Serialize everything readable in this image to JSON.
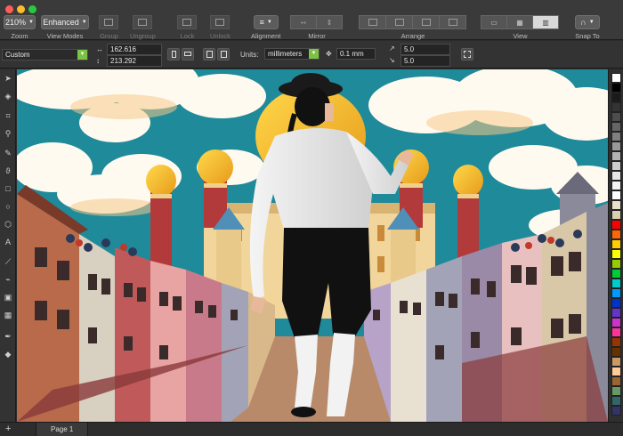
{
  "toolbar": {
    "zoom": {
      "value": "210%",
      "label": "Zoom"
    },
    "view_modes": {
      "value": "Enhanced",
      "label": "View Modes"
    },
    "group_label": "Group",
    "ungroup_label": "Ungroup",
    "lock_label": "Lock",
    "unlock_label": "Unlock",
    "alignment_label": "Alignment",
    "mirror_label": "Mirror",
    "arrange_label": "Arrange",
    "view_label": "View",
    "snap_to_label": "Snap To"
  },
  "property_bar": {
    "preset": "Custom",
    "x_value": "162.616",
    "y_value": "213.292",
    "units_label": "Units:",
    "units_value": "millimeters",
    "nudge_value": "0.1 mm",
    "duplicate_x": "5.0",
    "duplicate_y": "5.0"
  },
  "status": {
    "page_tab": "Page 1"
  },
  "colors": {
    "accent_green": "#7cc243",
    "sky": "#1f8a9a",
    "palette": [
      "#ffffff",
      "#000000",
      "#1a1a1a",
      "#333333",
      "#4d4d4d",
      "#666666",
      "#808080",
      "#999999",
      "#b3b3b3",
      "#cccccc",
      "#e6e6e6",
      "#f5f5f5",
      "#ffffff",
      "#e8e0c8",
      "#d9d0b0",
      "#ff0000",
      "#ff6600",
      "#ffcc00",
      "#ffff00",
      "#99cc00",
      "#00cc33",
      "#00cccc",
      "#0099ff",
      "#0033cc",
      "#6633cc",
      "#cc33cc",
      "#ff3399",
      "#993300",
      "#663300",
      "#cc9966",
      "#ffcc99",
      "#996633",
      "#669966",
      "#336666",
      "#333366"
    ]
  }
}
